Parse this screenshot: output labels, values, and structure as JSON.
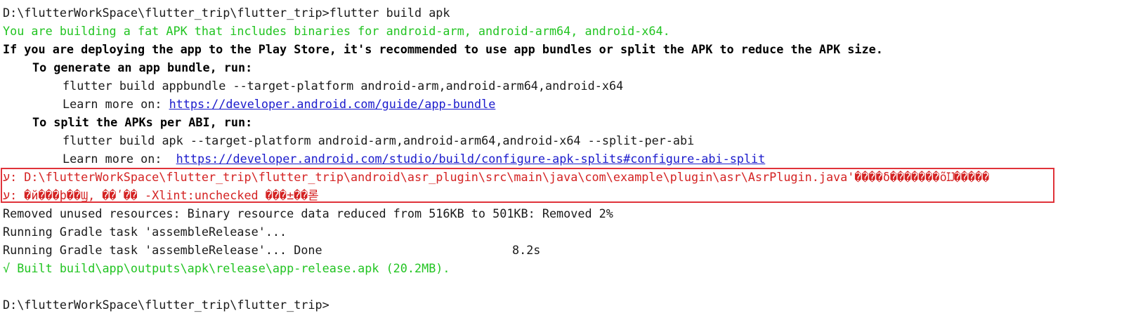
{
  "terminal": {
    "prompt_command": "D:\\flutterWorkSpace\\flutter_trip\\flutter_trip>flutter build apk",
    "fat_apk_notice": "You are building a fat APK that includes binaries for android-arm, android-arm64, android-x64.",
    "play_store_notice": "If you are deploying the app to the Play Store, it's recommended to use app bundles or split the APK to reduce the APK size.",
    "bundle_heading": "To generate an app bundle, run:",
    "bundle_command": "flutter build appbundle --target-platform android-arm,android-arm64,android-x64",
    "learn_more_label_1": "Learn more on: ",
    "learn_more_link_1": "https://developer.android.com/guide/app-bundle",
    "split_heading": "To split the APKs per ABI, run:",
    "split_command": "flutter build apk --target-platform android-arm,android-arm64,android-x64 --split-per-abi",
    "learn_more_label_2": "Learn more on:  ",
    "learn_more_link_2": "https://developer.android.com/studio/build/configure-apk-splits#configure-abi-split",
    "error_line_1": "ע: D:\\flutterWorkSpace\\flutter_trip\\flutter_trip\\android\\asr_plugin\\src\\main\\java\\com\\example\\plugin\\asr\\AsrPlugin.java'����δ�������õĲ�����",
    "error_line_2": "ע: �й���ϸ��Ϣ, ��ʹ�� -Xlint:unchecked ���±��롣",
    "removed_resources": "Removed unused resources: Binary resource data reduced from 516KB to 501KB: Removed 2%",
    "gradle_running": "Running Gradle task 'assembleRelease'...",
    "gradle_done": "Running Gradle task 'assembleRelease'... Done",
    "gradle_duration": "8.2s",
    "built_result": "√ Built build\\app\\outputs\\apk\\release\\app-release.apk (20.2MB).",
    "final_prompt": "D:\\flutterWorkSpace\\flutter_trip\\flutter_trip>"
  },
  "colors": {
    "success": "#22c422",
    "error": "#d42323",
    "highlight_box": "#e0333a",
    "link": "#1a1acc"
  }
}
